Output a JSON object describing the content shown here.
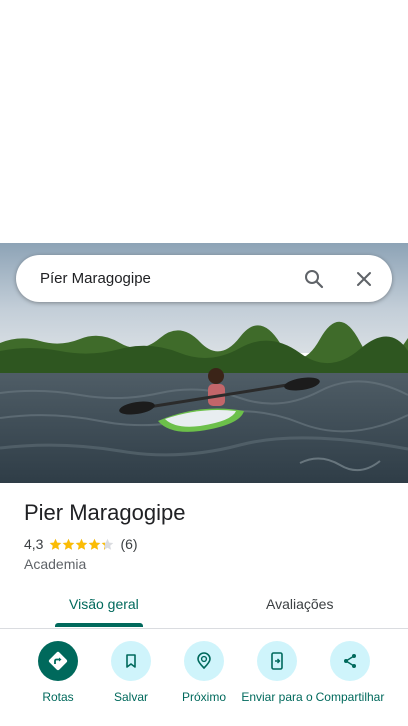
{
  "search": {
    "query": "Píer Maragogipe"
  },
  "place": {
    "name": "Pier Maragogipe",
    "rating": "4,3",
    "rating_value": 4.3,
    "review_count": "(6)",
    "category": "Academia"
  },
  "tabs": [
    {
      "label": "Visão geral",
      "active": true
    },
    {
      "label": "Avaliações",
      "active": false
    }
  ],
  "actions": [
    {
      "label": "Rotas",
      "icon": "directions-icon"
    },
    {
      "label": "Salvar",
      "icon": "bookmark-icon"
    },
    {
      "label": "Próximo",
      "icon": "nearby-icon"
    },
    {
      "label": "Enviar para o",
      "icon": "send-to-phone-icon"
    },
    {
      "label": "Compartilhar",
      "icon": "share-icon"
    }
  ],
  "colors": {
    "accent": "#00695c",
    "action_bg": "#cff4fb",
    "star": "#fbbc04"
  }
}
